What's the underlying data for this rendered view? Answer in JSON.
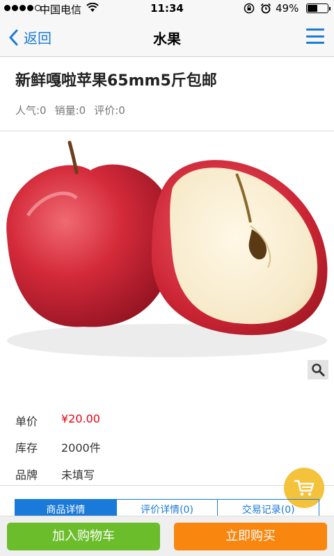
{
  "status_bar": {
    "carrier": "中国电信",
    "time": "11:34",
    "battery": "49%",
    "battery_level": 0.49
  },
  "nav": {
    "back_label": "返回",
    "title": "水果"
  },
  "product": {
    "title": "新鲜嘎啦苹果65mm5斤包邮",
    "stats": {
      "popularity": "人气:0",
      "sales": "销量:0",
      "reviews": "评价:0"
    }
  },
  "attributes": [
    {
      "label": "单价",
      "value": "¥20.00"
    },
    {
      "label": "库存",
      "value": "2000件"
    },
    {
      "label": "品牌",
      "value": "未填写"
    }
  ],
  "tabs": [
    {
      "label": "商品详情"
    },
    {
      "label": "评价详情(0)"
    },
    {
      "label": "交易记录(0)"
    }
  ],
  "actions": {
    "add_to_cart": "加入购物车",
    "buy_now": "立即购买"
  },
  "colors": {
    "accent": "#1a7ad9",
    "price": "#e60012",
    "add_to_cart": "#6cbd2c",
    "buy_now": "#f8860f",
    "cart_float": "#f5c23c"
  }
}
